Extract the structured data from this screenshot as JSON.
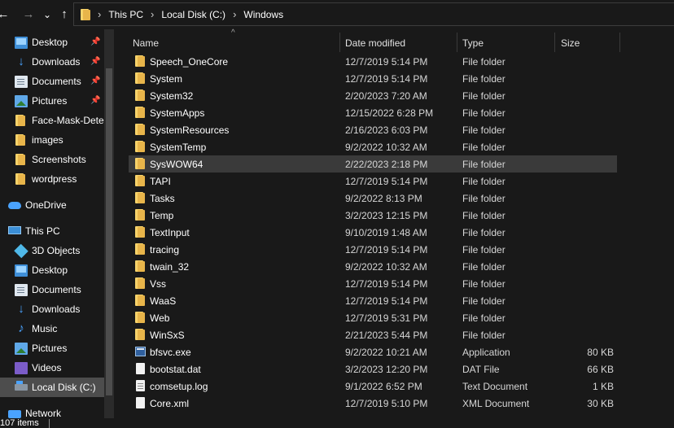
{
  "nav": {
    "back": "←",
    "forward": "→",
    "recent": "⌄",
    "up": "↑"
  },
  "address": {
    "crumbs": [
      "This PC",
      "Local Disk (C:)",
      "Windows"
    ],
    "separator": "›"
  },
  "sidebar": {
    "quick_access": [
      {
        "label": "Desktop",
        "icon": "desktop-icon",
        "pinned": true
      },
      {
        "label": "Downloads",
        "icon": "download-icon",
        "pinned": true
      },
      {
        "label": "Documents",
        "icon": "documents-icon",
        "pinned": true
      },
      {
        "label": "Pictures",
        "icon": "pictures-icon",
        "pinned": true
      },
      {
        "label": "Face-Mask-Dete",
        "icon": "folder-icon",
        "pinned": false
      },
      {
        "label": "images",
        "icon": "folder-icon",
        "pinned": false
      },
      {
        "label": "Screenshots",
        "icon": "folder-icon",
        "pinned": false
      },
      {
        "label": "wordpress",
        "icon": "folder-icon",
        "pinned": false
      }
    ],
    "onedrive": "OneDrive",
    "this_pc": "This PC",
    "this_pc_items": [
      {
        "label": "3D Objects",
        "icon": "3d-objects-icon"
      },
      {
        "label": "Desktop",
        "icon": "desktop-icon"
      },
      {
        "label": "Documents",
        "icon": "documents-icon"
      },
      {
        "label": "Downloads",
        "icon": "download-icon"
      },
      {
        "label": "Music",
        "icon": "music-icon"
      },
      {
        "label": "Pictures",
        "icon": "pictures-icon"
      },
      {
        "label": "Videos",
        "icon": "videos-icon"
      },
      {
        "label": "Local Disk (C:)",
        "icon": "local-disk-icon",
        "selected": true
      }
    ],
    "network": "Network",
    "pin_glyph": "📌"
  },
  "columns": {
    "name": "Name",
    "date": "Date modified",
    "type": "Type",
    "size": "Size",
    "sort_glyph": "^"
  },
  "files": [
    {
      "name": "Speech_OneCore",
      "date": "12/7/2019 5:14 PM",
      "type": "File folder",
      "size": "",
      "kind": "folder"
    },
    {
      "name": "System",
      "date": "12/7/2019 5:14 PM",
      "type": "File folder",
      "size": "",
      "kind": "folder"
    },
    {
      "name": "System32",
      "date": "2/20/2023 7:20 AM",
      "type": "File folder",
      "size": "",
      "kind": "folder"
    },
    {
      "name": "SystemApps",
      "date": "12/15/2022 6:28 PM",
      "type": "File folder",
      "size": "",
      "kind": "folder"
    },
    {
      "name": "SystemResources",
      "date": "2/16/2023 6:03 PM",
      "type": "File folder",
      "size": "",
      "kind": "folder"
    },
    {
      "name": "SystemTemp",
      "date": "9/2/2022 10:32 AM",
      "type": "File folder",
      "size": "",
      "kind": "folder"
    },
    {
      "name": "SysWOW64",
      "date": "2/22/2023 2:18 PM",
      "type": "File folder",
      "size": "",
      "kind": "folder",
      "selected": true
    },
    {
      "name": "TAPI",
      "date": "12/7/2019 5:14 PM",
      "type": "File folder",
      "size": "",
      "kind": "folder"
    },
    {
      "name": "Tasks",
      "date": "9/2/2022 8:13 PM",
      "type": "File folder",
      "size": "",
      "kind": "folder"
    },
    {
      "name": "Temp",
      "date": "3/2/2023 12:15 PM",
      "type": "File folder",
      "size": "",
      "kind": "folder"
    },
    {
      "name": "TextInput",
      "date": "9/10/2019 1:48 AM",
      "type": "File folder",
      "size": "",
      "kind": "folder"
    },
    {
      "name": "tracing",
      "date": "12/7/2019 5:14 PM",
      "type": "File folder",
      "size": "",
      "kind": "folder"
    },
    {
      "name": "twain_32",
      "date": "9/2/2022 10:32 AM",
      "type": "File folder",
      "size": "",
      "kind": "folder"
    },
    {
      "name": "Vss",
      "date": "12/7/2019 5:14 PM",
      "type": "File folder",
      "size": "",
      "kind": "folder"
    },
    {
      "name": "WaaS",
      "date": "12/7/2019 5:14 PM",
      "type": "File folder",
      "size": "",
      "kind": "folder"
    },
    {
      "name": "Web",
      "date": "12/7/2019 5:31 PM",
      "type": "File folder",
      "size": "",
      "kind": "folder"
    },
    {
      "name": "WinSxS",
      "date": "2/21/2023 5:44 PM",
      "type": "File folder",
      "size": "",
      "kind": "folder"
    },
    {
      "name": "bfsvc.exe",
      "date": "9/2/2022 10:21 AM",
      "type": "Application",
      "size": "80 KB",
      "kind": "exe"
    },
    {
      "name": "bootstat.dat",
      "date": "3/2/2023 12:20 PM",
      "type": "DAT File",
      "size": "66 KB",
      "kind": "plain"
    },
    {
      "name": "comsetup.log",
      "date": "9/1/2022 6:52 PM",
      "type": "Text Document",
      "size": "1 KB",
      "kind": "doc"
    },
    {
      "name": "Core.xml",
      "date": "12/7/2019 5:10 PM",
      "type": "XML Document",
      "size": "30 KB",
      "kind": "plain"
    }
  ],
  "status": {
    "item_count": "107 items"
  }
}
